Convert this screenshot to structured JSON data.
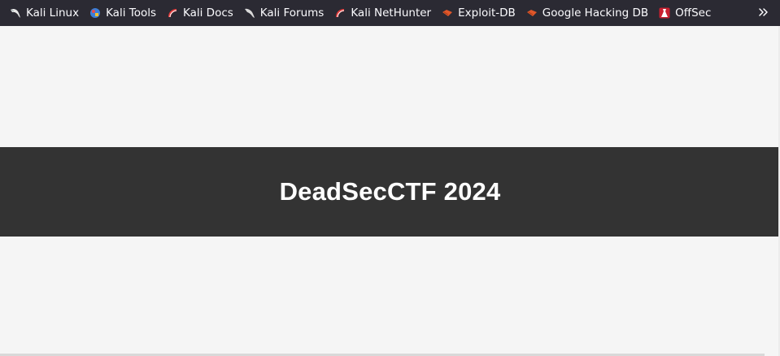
{
  "bookmarks": [
    {
      "label": "Kali Linux",
      "icon": "kali-dragon-icon"
    },
    {
      "label": "Kali Tools",
      "icon": "kali-tools-icon"
    },
    {
      "label": "Kali Docs",
      "icon": "kali-docs-icon"
    },
    {
      "label": "Kali Forums",
      "icon": "kali-forums-icon"
    },
    {
      "label": "Kali NetHunter",
      "icon": "kali-nethunter-icon"
    },
    {
      "label": "Exploit-DB",
      "icon": "exploit-db-icon"
    },
    {
      "label": "Google Hacking DB",
      "icon": "google-hacking-db-icon"
    },
    {
      "label": "OffSec",
      "icon": "offsec-icon"
    }
  ],
  "overflow_icon": "chevron-double-right-icon",
  "page": {
    "title": "DeadSecCTF 2024"
  },
  "colors": {
    "toolbar_bg": "#2b2a33",
    "toolbar_text": "#fbfbfe",
    "page_bg": "#f5f5f5",
    "title_band_bg": "#333333",
    "title_text": "#ffffff",
    "exploit_orange": "#e0572a",
    "offsec_red": "#c8202f"
  }
}
